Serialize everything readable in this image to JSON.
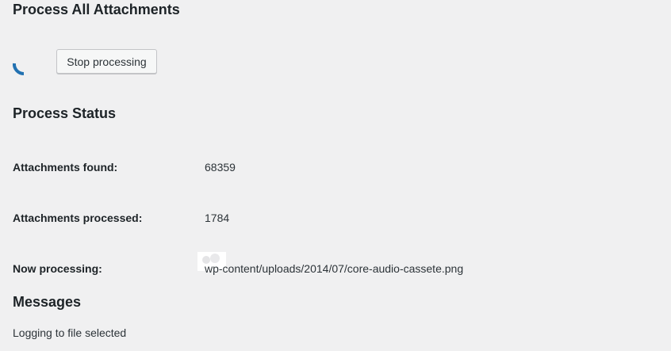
{
  "process_section": {
    "title": "Process All Attachments",
    "stop_button_label": "Stop processing"
  },
  "status_section": {
    "title": "Process Status",
    "rows": [
      {
        "label": "Attachments found:",
        "value": "68359"
      },
      {
        "label": "Attachments processed:",
        "value": "1784"
      },
      {
        "label": "Now processing:",
        "value": "wp-content/uploads/2014/07/core-audio-cassete.png"
      }
    ]
  },
  "messages_section": {
    "title": "Messages",
    "items": [
      "Logging to file selected"
    ]
  },
  "colors": {
    "background": "#f0f0f1",
    "spinner": "#2271b1",
    "text": "#1d2327"
  },
  "icons": {
    "spinner": "loading-spinner-icon",
    "thumbnail": "attachment-thumbnail-icon"
  }
}
